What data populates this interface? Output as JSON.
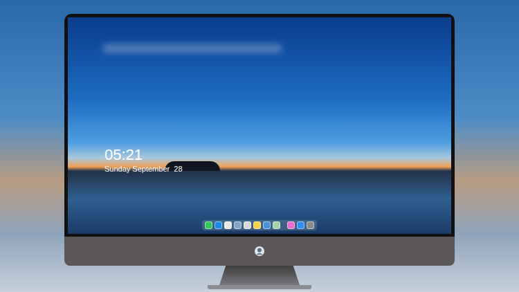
{
  "screen": {
    "clock": {
      "time": "05:21",
      "date": "Sunday September  28"
    },
    "dock": {
      "sections": [
        [
          {
            "color": "#34c759"
          },
          {
            "color": "#1e88e5"
          },
          {
            "color": "#e8e8e8"
          },
          {
            "color": "#7fa6c9"
          },
          {
            "color": "#d9d9d9"
          },
          {
            "color": "#f5d547"
          },
          {
            "color": "#4a90d9"
          },
          {
            "color": "#9fd3a8"
          }
        ],
        [
          {
            "color": "#e86fd0"
          },
          {
            "color": "#2f8cf0"
          },
          {
            "color": "#8a8a8a"
          }
        ]
      ]
    }
  }
}
